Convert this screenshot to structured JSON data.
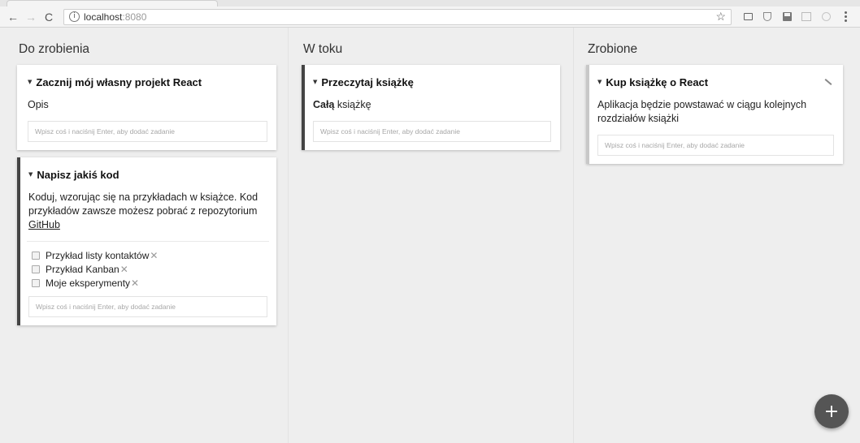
{
  "browser": {
    "address_host": "localhost",
    "address_port": ":8080",
    "back_glyph": "←",
    "forward_glyph": "→",
    "reload_glyph": "C",
    "info_glyph": "i",
    "bookmark_glyph": "☆",
    "icons": [
      "arrow-left-icon",
      "arrow-right-icon",
      "reload-icon",
      "info-icon",
      "star-icon",
      "cast-icon",
      "shield-icon",
      "save-icon",
      "grid-icon",
      "circle-icon",
      "menu-icon"
    ]
  },
  "lanes": [
    {
      "title": "Do zrobienia",
      "notes": [
        {
          "title": "Zacznij mój własny projekt React",
          "description": "Opis",
          "input_placeholder": "Wpisz coś i naciśnij Enter, aby dodać zadanie"
        },
        {
          "title": "Napisz jakiś kod",
          "description": "Koduj, wzorując się na przykładach w książce. Kod przykładów zawsze możesz pobrać z repozytorium ",
          "description_link": "GitHub",
          "tasks": [
            {
              "label": "Przykład listy kontaktów",
              "done": false
            },
            {
              "label": "Przykład Kanban",
              "done": false
            },
            {
              "label": "Moje eksperymenty",
              "done": false
            }
          ],
          "input_placeholder": "Wpisz coś i naciśnij Enter, aby dodać zadanie"
        }
      ]
    },
    {
      "title": "W toku",
      "notes": [
        {
          "title": "Przeczytaj książkę",
          "description_bold": "Całą",
          "description": " książkę",
          "input_placeholder": "Wpisz coś i naciśnij Enter, aby dodać zadanie"
        }
      ]
    },
    {
      "title": "Zrobione",
      "notes": [
        {
          "title": "Kup książkę o React",
          "description": "Aplikacja będzie powstawać w ciągu kolejnych rozdziałów książki",
          "input_placeholder": "Wpisz coś i naciśnij Enter, aby dodać zadanie"
        }
      ]
    }
  ],
  "caret_glyph": "▼",
  "delete_glyph": "✕",
  "fab_glyph": "+",
  "colors": {
    "accent_dark": "#444444",
    "accent_light": "#c8c8c8",
    "fab": "#555555",
    "background": "#eeeeee"
  }
}
